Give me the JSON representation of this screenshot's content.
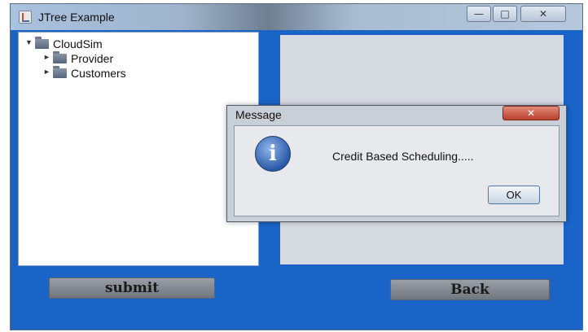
{
  "window": {
    "title": "JTree Example",
    "controls": {
      "minimize": "—",
      "maximize": "□",
      "close": "✕"
    }
  },
  "tree": {
    "nodes": [
      {
        "label": "CloudSim",
        "expanded": true,
        "arrow": "▼",
        "icon": "folder-icon"
      },
      {
        "label": "Provider",
        "expanded": false,
        "arrow": "►",
        "icon": "folder-icon"
      },
      {
        "label": "Customers",
        "expanded": false,
        "arrow": "►",
        "icon": "folder-icon"
      }
    ]
  },
  "buttons": {
    "submit": "submit",
    "back": "Back"
  },
  "dialog": {
    "title": "Message",
    "close": "✕",
    "icon": "i",
    "message": "Credit Based Scheduling.....",
    "ok": "OK"
  },
  "colors": {
    "window_bg": "#1a64c8",
    "panel_bg": "#d6dae1",
    "dialog_close": "#c5503c"
  }
}
